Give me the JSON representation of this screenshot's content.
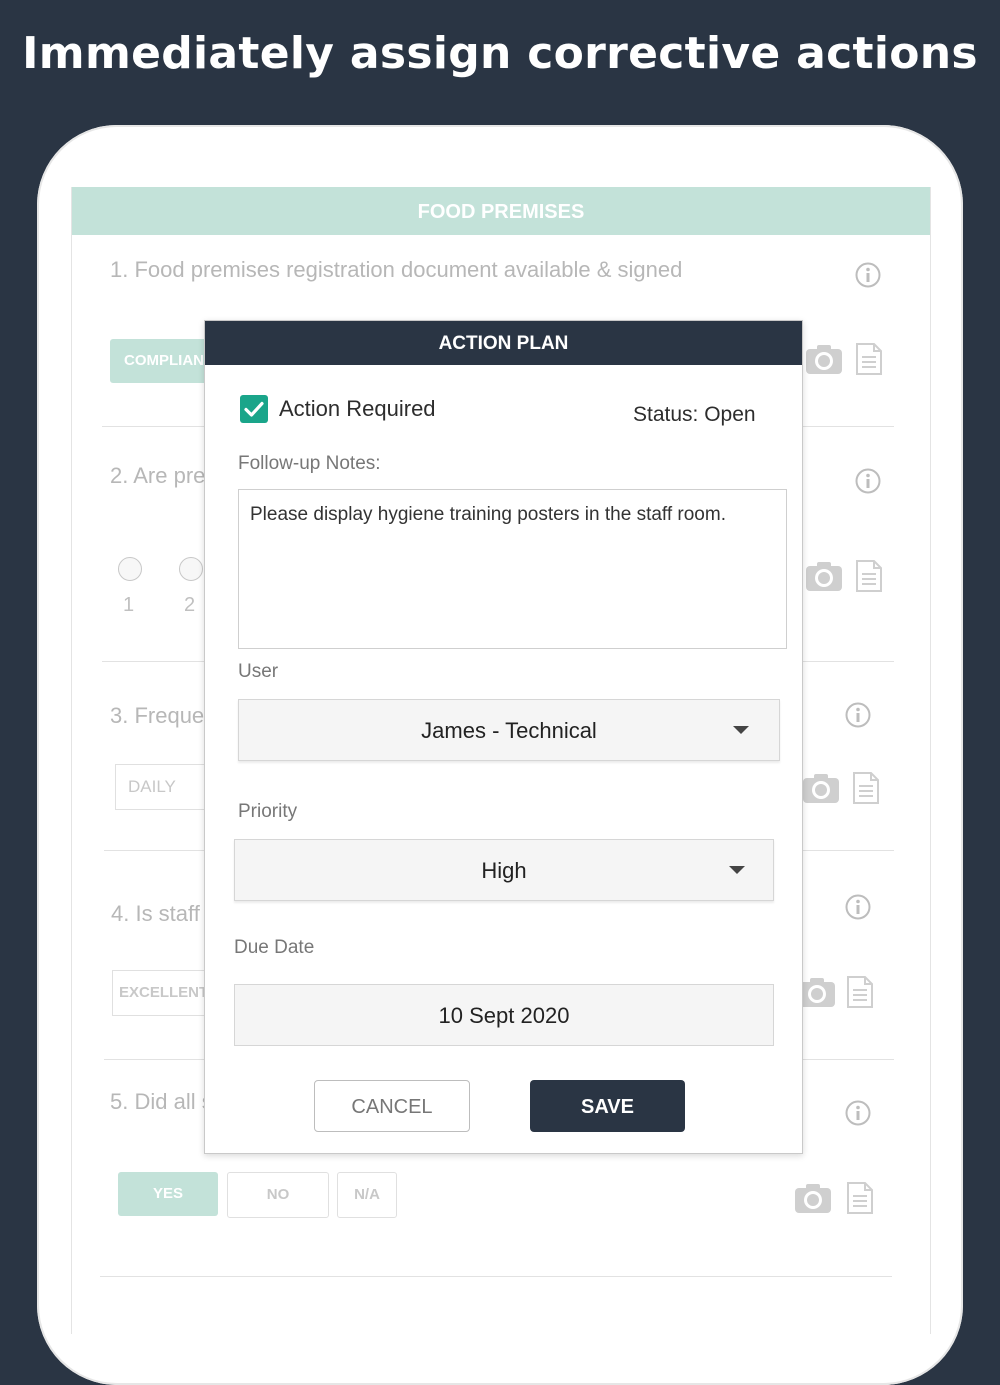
{
  "headline": "Immediately assign corrective actions",
  "section": {
    "title": "FOOD PREMISES"
  },
  "questions": [
    {
      "text": "1. Food premises registration document available & signed",
      "answer": "COMPLIANT"
    },
    {
      "text": "2. Are pre",
      "options": [
        "1",
        "2"
      ]
    },
    {
      "text": "3. Freque",
      "value": "DAILY"
    },
    {
      "text": "4. Is staff",
      "value": "EXCELLENT"
    },
    {
      "text": "5. Did all s",
      "buttons": [
        "YES",
        "NO",
        "N/A"
      ]
    }
  ],
  "icons": {
    "info": "info-icon",
    "camera": "camera-icon",
    "document": "document-icon",
    "check": "checkmark-icon",
    "dropdown": "caret-down-icon"
  },
  "colors": {
    "background": "#2a3544",
    "accent_mint": "#c3e2d9",
    "checkbox_teal": "#1aa58a",
    "primary_button": "#2a3544"
  },
  "modal": {
    "title": "ACTION PLAN",
    "action_required_label": "Action Required",
    "action_required_checked": true,
    "status": "Status: Open",
    "notes_label": "Follow-up Notes:",
    "notes_value": "Please display hygiene training posters in the staff room.",
    "user_label": "User",
    "user_value": "James  - Technical",
    "priority_label": "Priority",
    "priority_value": "High",
    "due_date_label": "Due Date",
    "due_date_value": "10  Sept 2020",
    "cancel_label": "CANCEL",
    "save_label": "SAVE"
  }
}
